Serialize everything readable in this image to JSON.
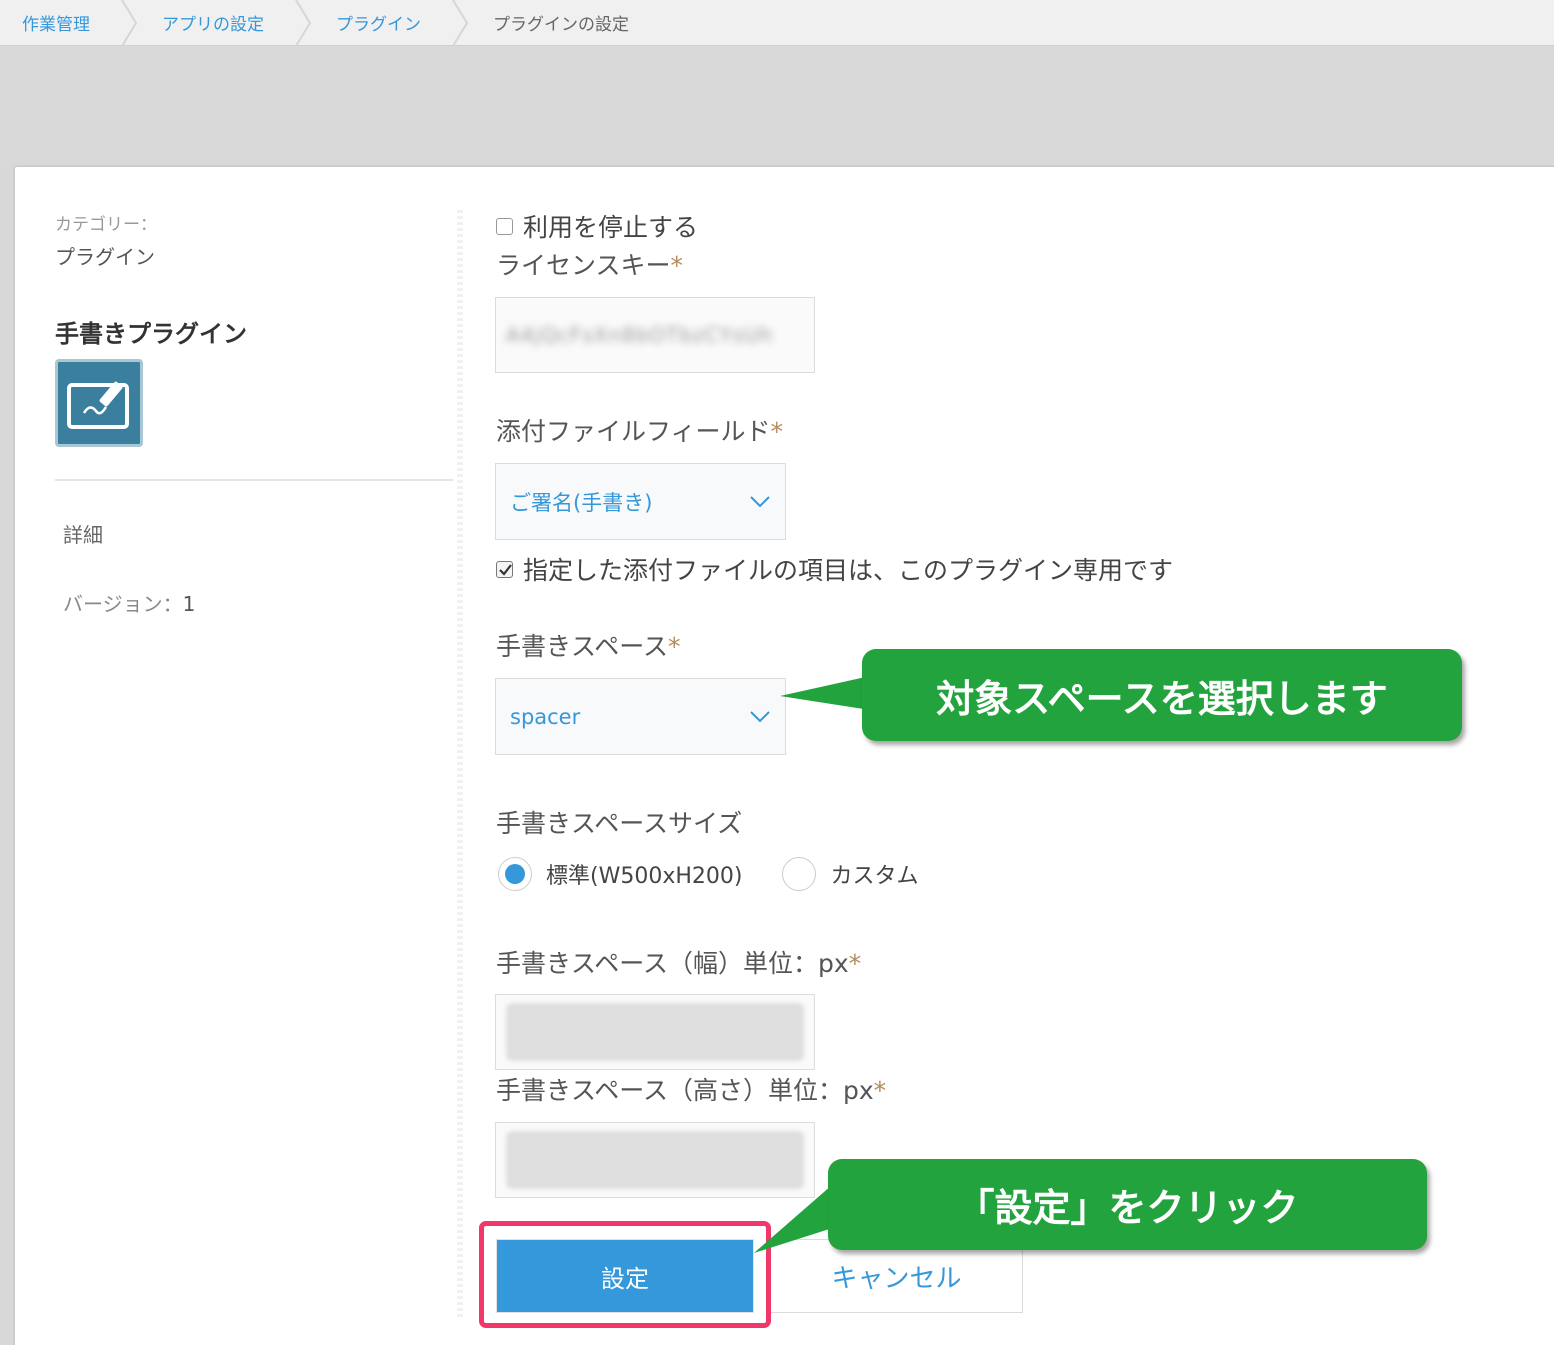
{
  "breadcrumb": {
    "items": [
      "作業管理",
      "アプリの設定",
      "プラグイン"
    ],
    "current": "プラグインの設定"
  },
  "sidebar": {
    "category_label": "カテゴリー：",
    "category_value": "プラグイン",
    "plugin_name": "手書きプラグイン",
    "detail_link": "詳細",
    "version_label": "バージョン：",
    "version_value": "1"
  },
  "form": {
    "disable_checkbox": {
      "label": "利用を停止する",
      "checked": false
    },
    "license_key": {
      "label": "ライセンスキー",
      "required_mark": "*",
      "value": "A4jQcFsXn8bOTbzCYsUh"
    },
    "attachment_field": {
      "label": "添付ファイルフィールド",
      "required_mark": "*",
      "selected": "ご署名(手書き)"
    },
    "dedicated_checkbox": {
      "label": "指定した添付ファイルの項目は、このプラグイン専用です",
      "checked": true
    },
    "space": {
      "label": "手書きスペース",
      "required_mark": "*",
      "selected": "spacer"
    },
    "space_size": {
      "label": "手書きスペースサイズ",
      "options": [
        {
          "label": "標準(W500xH200)",
          "selected": true
        },
        {
          "label": "カスタム",
          "selected": false
        }
      ]
    },
    "width": {
      "label": "手書きスペース（幅）単位：px",
      "required_mark": "*"
    },
    "height": {
      "label": "手書きスペース（高さ）単位：px",
      "required_mark": "*"
    }
  },
  "buttons": {
    "save": "設定",
    "cancel": "キャンセル"
  },
  "annotations": {
    "select_space": "対象スペースを選択します",
    "click_save": "「設定」をクリック"
  },
  "colors": {
    "accent": "#3498db",
    "callout_green": "#22a33e",
    "highlight_pink": "#f0386b",
    "required_mark": "#b5895b",
    "plugin_icon_bg": "#3b7f9e"
  }
}
